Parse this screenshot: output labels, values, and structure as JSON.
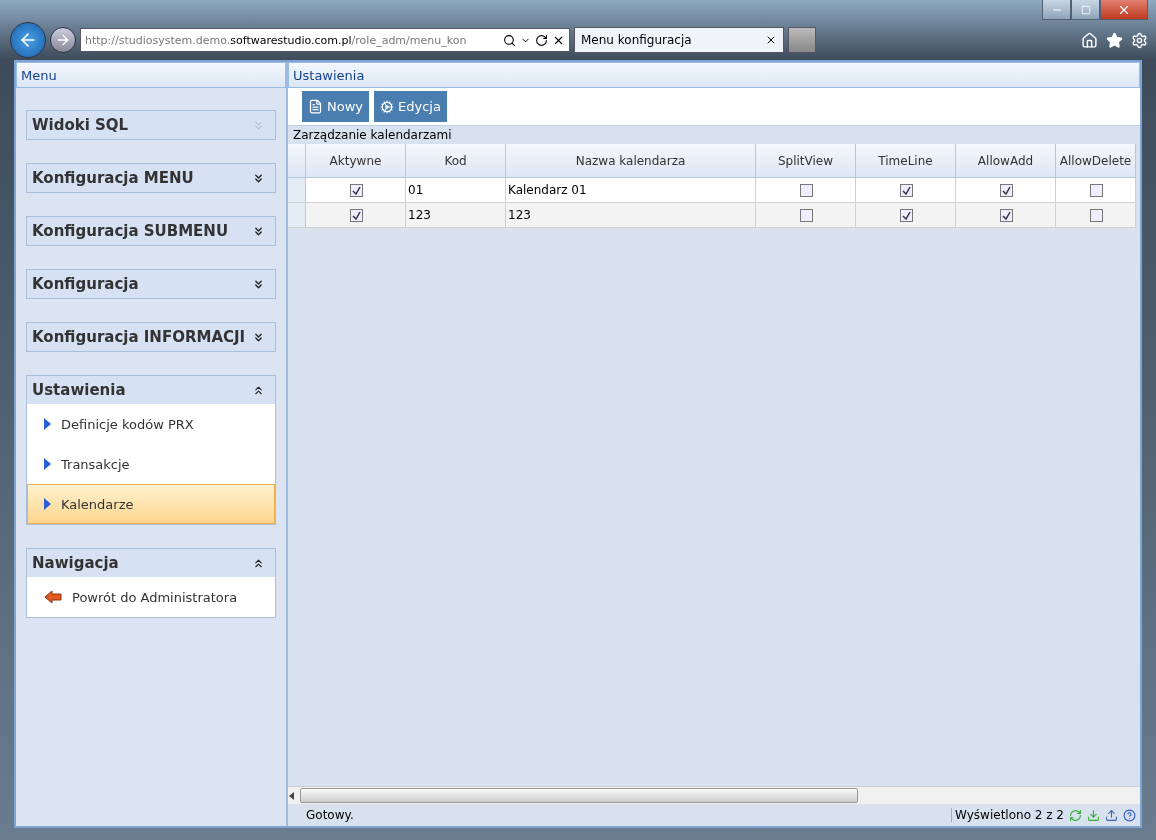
{
  "browser": {
    "url": {
      "prefix": "http://studiosystem.demo.",
      "domain": "softwarestudio.com.pl",
      "path": "/role_adm/menu_kon"
    },
    "tab_title": "Menu konfiguracja"
  },
  "sidebar": {
    "title": "Menu",
    "sections": [
      {
        "title": "Widoki SQL",
        "expanded": false,
        "disabled": true
      },
      {
        "title": "Konfiguracja MENU",
        "expanded": false,
        "disabled": false
      },
      {
        "title": "Konfiguracja SUBMENU",
        "expanded": false,
        "disabled": false
      },
      {
        "title": "Konfiguracja",
        "expanded": false,
        "disabled": false
      },
      {
        "title": "Konfiguracja INFORMACJI",
        "expanded": false,
        "disabled": false
      },
      {
        "title": "Ustawienia",
        "expanded": true,
        "disabled": false,
        "items": [
          {
            "label": "Definicje kodów PRX",
            "kind": "arrow",
            "selected": false
          },
          {
            "label": "Transakcje",
            "kind": "arrow",
            "selected": false
          },
          {
            "label": "Kalendarze",
            "kind": "arrow",
            "selected": true
          }
        ]
      },
      {
        "title": "Nawigacja",
        "expanded": true,
        "disabled": false,
        "items": [
          {
            "label": "Powrót do Administratora",
            "kind": "back",
            "selected": false
          }
        ]
      }
    ]
  },
  "main": {
    "title": "Ustawienia",
    "toolbar": [
      {
        "label": "Nowy",
        "kind": "new"
      },
      {
        "label": "Edycja",
        "kind": "edit"
      }
    ],
    "grid": {
      "caption": "Zarządzanie kalendarzami",
      "columns": [
        "Aktywne",
        "Kod",
        "Nazwa kalendarza",
        "SplitView",
        "TimeLine",
        "AllowAdd",
        "AllowDelete"
      ],
      "rows": [
        {
          "cells": [
            {
              "kind": "check",
              "checked": true
            },
            {
              "kind": "text",
              "text": "01"
            },
            {
              "kind": "text",
              "text": "Kalendarz 01"
            },
            {
              "kind": "check",
              "checked": false
            },
            {
              "kind": "check",
              "checked": true
            },
            {
              "kind": "check",
              "checked": true
            },
            {
              "kind": "check",
              "checked": false
            }
          ]
        },
        {
          "cells": [
            {
              "kind": "check",
              "checked": true
            },
            {
              "kind": "text",
              "text": "123"
            },
            {
              "kind": "text",
              "text": "123"
            },
            {
              "kind": "check",
              "checked": false
            },
            {
              "kind": "check",
              "checked": true
            },
            {
              "kind": "check",
              "checked": true
            },
            {
              "kind": "check",
              "checked": false
            }
          ]
        }
      ]
    },
    "status": "Gotowy.",
    "count": "Wyświetlono 2 z 2"
  }
}
